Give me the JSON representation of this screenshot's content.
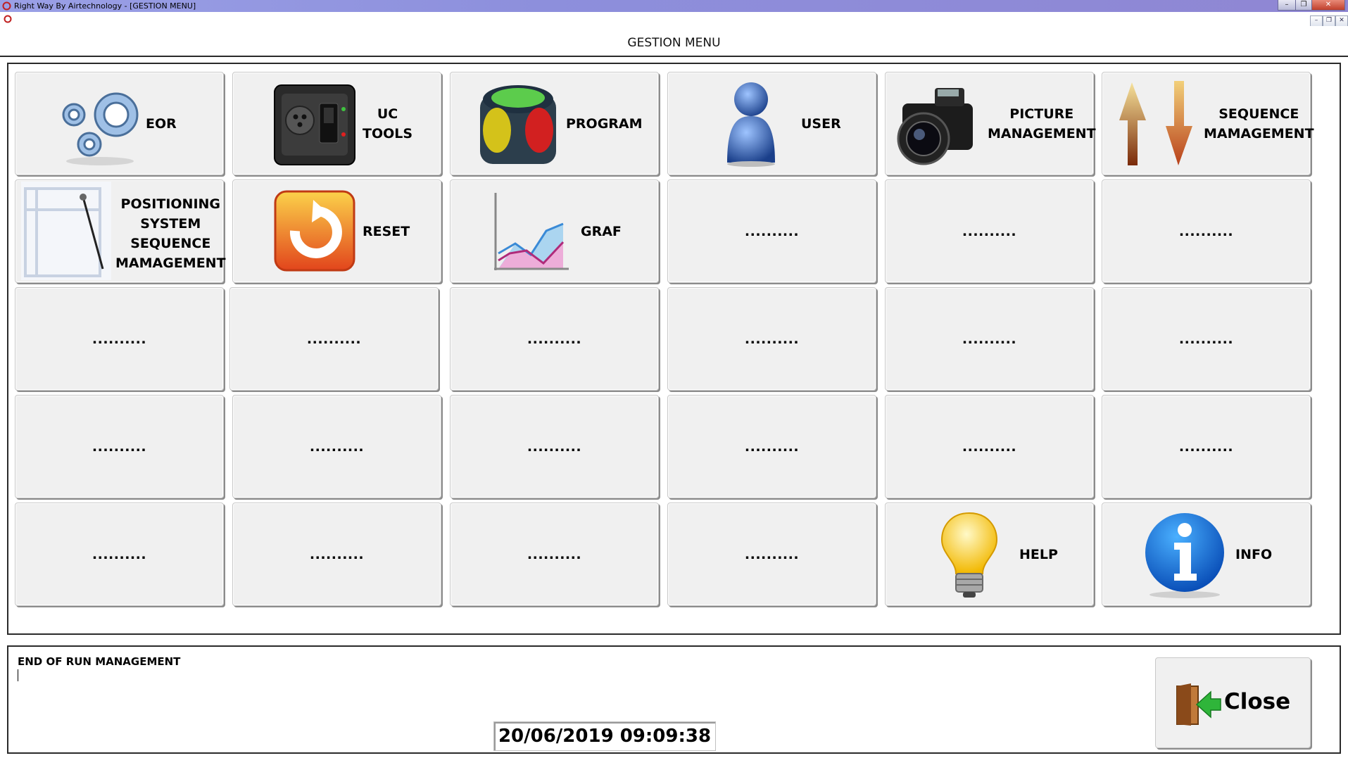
{
  "window": {
    "title": "Right Way By  Airtechnology - [GESTION MENU]",
    "minimize": "–",
    "maximize": "❐",
    "close": "✕"
  },
  "mdi": {
    "minimize": "–",
    "restore": "❐",
    "close": "✕"
  },
  "header": {
    "title": "GESTION MENU"
  },
  "tiles": {
    "eor": {
      "label": "EOR"
    },
    "uc_tools": {
      "label1": "UC",
      "label2": "TOOLS"
    },
    "program": {
      "label": "PROGRAM"
    },
    "user": {
      "label": "USER"
    },
    "picture": {
      "label1": "PICTURE",
      "label2": "MANAGEMENT"
    },
    "sequence": {
      "label1": "SEQUENCE",
      "label2": "MAMAGEMENT"
    },
    "positioning": {
      "label1": "POSITIONING",
      "label2": "SYSTEM",
      "label3": "SEQUENCE",
      "label4": "MAMAGEMENT"
    },
    "reset": {
      "label": "RESET"
    },
    "graf": {
      "label": "GRAF"
    },
    "help": {
      "label": "HELP"
    },
    "info": {
      "label": "INFO"
    },
    "placeholder": ".........."
  },
  "status": {
    "text": "END OF RUN MANAGEMENT"
  },
  "datetime": "20/06/2019 09:09:38",
  "close_button": {
    "label": "Close"
  }
}
